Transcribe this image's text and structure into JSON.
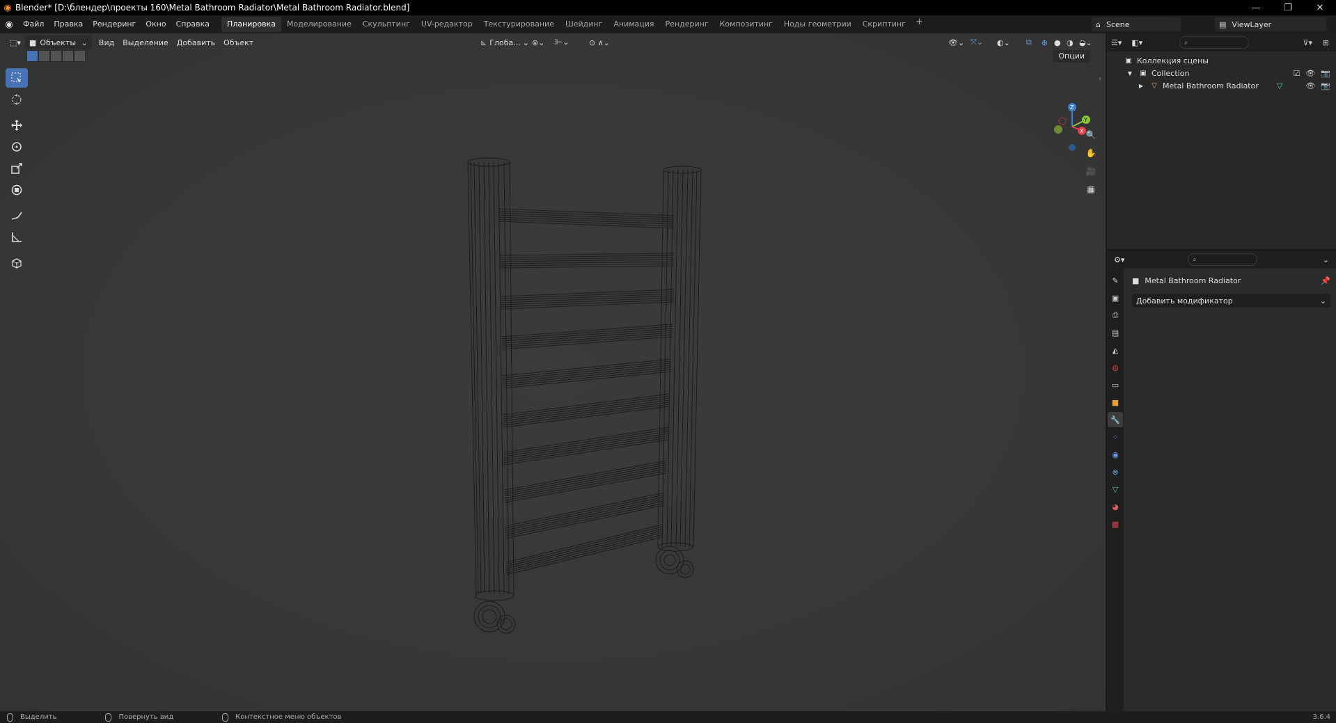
{
  "window": {
    "title": "Blender* [D:\\блендер\\проекты 160\\Metal Bathroom Radiator\\Metal Bathroom Radiator.blend]",
    "controls": [
      "minimize-icon",
      "restore-icon",
      "close-icon"
    ]
  },
  "menu": {
    "items": [
      "Файл",
      "Правка",
      "Рендеринг",
      "Окно",
      "Справка"
    ]
  },
  "workspaces": {
    "tabs": [
      "Планировка",
      "Моделирование",
      "Скульптинг",
      "UV-редактор",
      "Текстурирование",
      "Шейдинг",
      "Анимация",
      "Рендеринг",
      "Композитинг",
      "Ноды геометрии",
      "Скриптинг"
    ],
    "active": "Планировка",
    "add": "+"
  },
  "scene": {
    "name": "Scene",
    "view_layer": "ViewLayer"
  },
  "viewport_header": {
    "mode": "Объекты",
    "menus": [
      "Вид",
      "Выделение",
      "Добавить",
      "Объект"
    ],
    "orientation": "Глоба...",
    "options": "Опции"
  },
  "outliner": {
    "root": "Коллекция сцены",
    "collection": "Collection",
    "object": "Metal Bathroom Radiator"
  },
  "properties": {
    "object_name": "Metal Bathroom Radiator",
    "add_modifier": "Добавить модификатор",
    "active_tab": "wrench-icon"
  },
  "statusbar": {
    "items": [
      "Выделить",
      "Повернуть вид",
      "Контекстное меню объектов"
    ],
    "version": "3.6.4"
  },
  "colors": {
    "accent": "#4772b3",
    "axis_x": "#e0404a",
    "axis_y": "#88c438",
    "axis_z": "#3a7fd0",
    "background": "#383838"
  }
}
